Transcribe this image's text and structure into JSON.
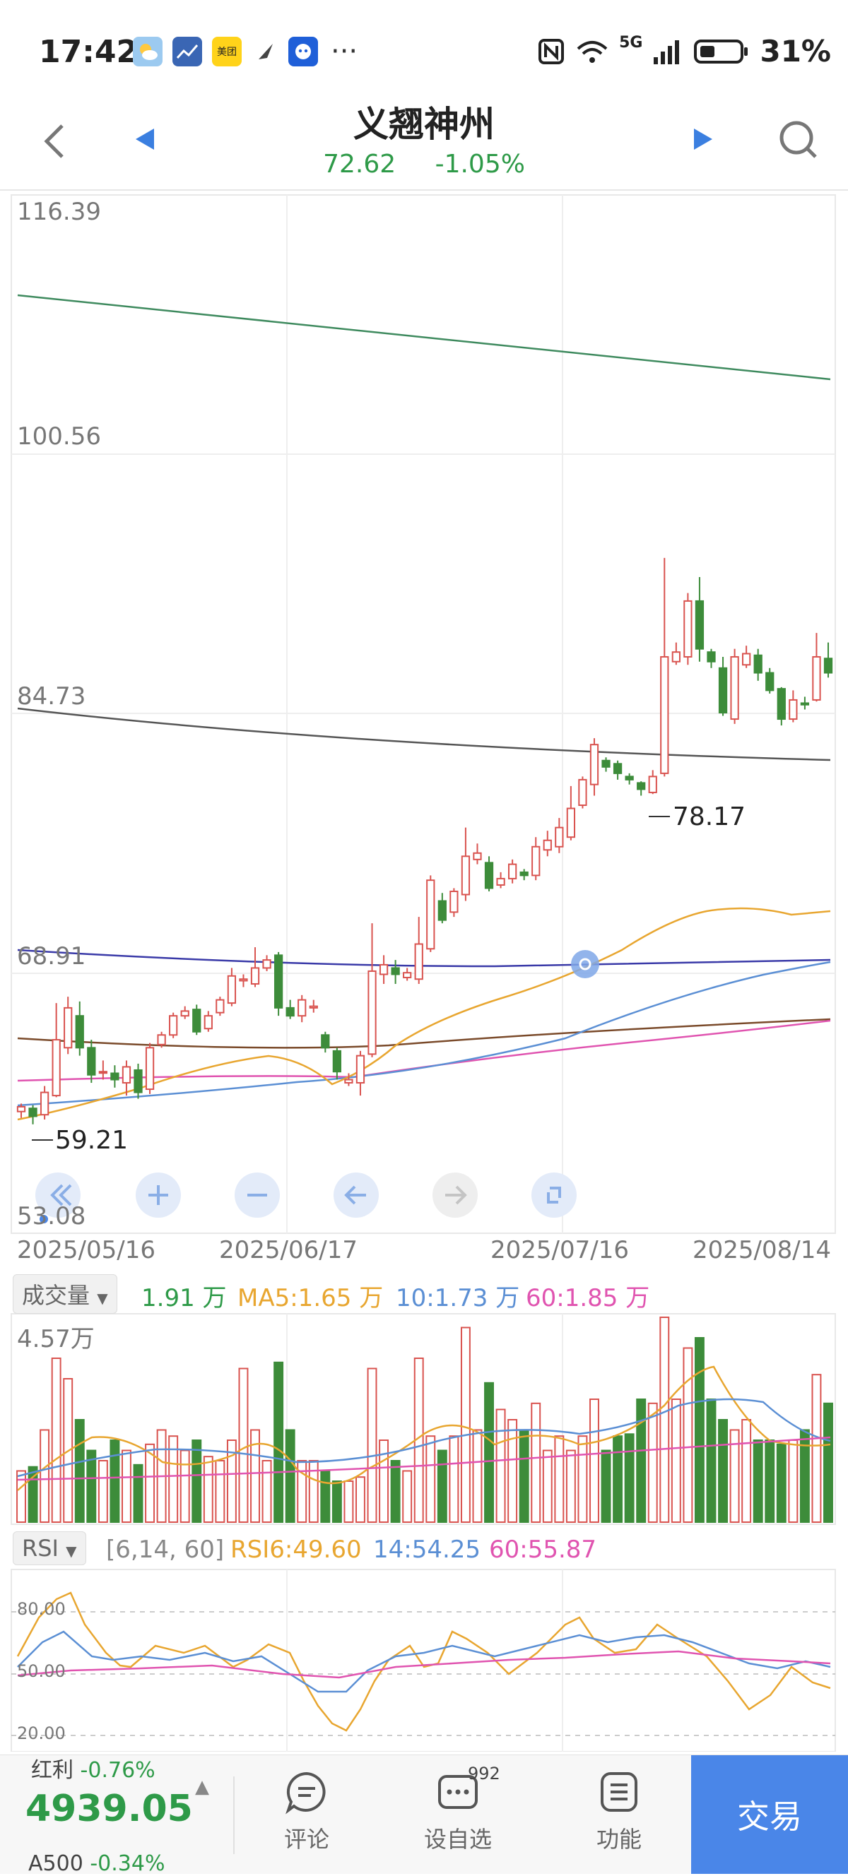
{
  "status": {
    "time": "17:42",
    "app_icons": [
      "weather-icon",
      "stocks-icon",
      "meituan-icon",
      "feather-icon",
      "bot-icon"
    ],
    "meituan_label": "美团",
    "more": "···",
    "network": "5G",
    "battery": "31%"
  },
  "header": {
    "title": "义翘神州",
    "price": "72.62",
    "change": "-1.05%"
  },
  "price_axis": [
    "116.39",
    "100.56",
    "84.73",
    "68.91",
    "53.08"
  ],
  "annotations": {
    "high": "78.17",
    "low": "59.21"
  },
  "dates": [
    "2025/05/16",
    "2025/06/17",
    "2025/07/16",
    "2025/08/14"
  ],
  "chart_tools": [
    "rewind-icon",
    "zoom-in-icon",
    "zoom-out-icon",
    "left-arrow-icon",
    "right-arrow-icon",
    "fullscreen-icon"
  ],
  "volume": {
    "selector": "成交量",
    "current": "1.91 万",
    "ma5": "MA5:1.65 万",
    "ma10": "10:1.73 万",
    "ma60": "60:1.85 万",
    "max_label": "4.57万"
  },
  "rsi": {
    "selector": "RSI",
    "params": "[6,14, 60]",
    "rsi6": "RSI6:49.60",
    "rsi14": "14:54.25",
    "rsi60": "60:55.87",
    "levels": [
      "80.00",
      "50.00",
      "20.00"
    ]
  },
  "bottom": {
    "index_top": "红利",
    "index_top_change": "-0.76%",
    "index_value": "4939.05",
    "index_bottom": "A500",
    "index_bottom_change": "-0.34%",
    "comment": "评论",
    "watch": "设自选",
    "watch_count": "992",
    "functions": "功能",
    "trade": "交易"
  },
  "colors": {
    "up": "#d9534f",
    "down": "#3d8c3a",
    "ma5": "#e8a630",
    "ma10": "#5b8fd4",
    "ma60": "#e054b0",
    "accent": "#4a86e8"
  },
  "chart_data": {
    "type": "candlestick",
    "ylim": [
      53.08,
      116.39
    ],
    "candles": [
      [
        60.0,
        60.3,
        59.6,
        60.5
      ],
      [
        60.2,
        59.7,
        59.2,
        60.4
      ],
      [
        59.8,
        61.2,
        59.5,
        61.6
      ],
      [
        61.0,
        64.5,
        60.9,
        66.8
      ],
      [
        64.0,
        66.5,
        63.6,
        67.2
      ],
      [
        66.0,
        64.0,
        63.5,
        66.9
      ],
      [
        64.0,
        62.3,
        61.8,
        64.5
      ],
      [
        62.5,
        62.5,
        62.0,
        63.2
      ],
      [
        62.4,
        62.0,
        61.5,
        62.9
      ],
      [
        61.8,
        62.8,
        61.0,
        63.2
      ],
      [
        62.6,
        61.2,
        60.8,
        63.0
      ],
      [
        61.4,
        64.0,
        61.1,
        64.3
      ],
      [
        64.2,
        64.8,
        64.0,
        65.0
      ],
      [
        64.8,
        66.0,
        64.6,
        66.2
      ],
      [
        66.0,
        66.3,
        65.8,
        66.6
      ],
      [
        66.4,
        65.0,
        64.8,
        66.7
      ],
      [
        65.2,
        66.0,
        65.0,
        66.3
      ],
      [
        66.2,
        67.0,
        66.0,
        67.2
      ],
      [
        66.8,
        68.5,
        66.6,
        69.0
      ],
      [
        68.2,
        68.3,
        67.8,
        68.6
      ],
      [
        68.0,
        69.0,
        67.8,
        70.3
      ],
      [
        69.0,
        69.5,
        68.8,
        69.8
      ],
      [
        69.8,
        66.5,
        66.0,
        70.0
      ],
      [
        66.5,
        66.0,
        65.8,
        67.0
      ],
      [
        66.0,
        67.0,
        65.6,
        67.3
      ],
      [
        66.5,
        66.6,
        66.2,
        67.0
      ],
      [
        64.8,
        64.0,
        63.7,
        65.0
      ],
      [
        63.8,
        62.5,
        62.0,
        64.0
      ],
      [
        61.8,
        62.0,
        61.6,
        62.4
      ],
      [
        61.8,
        63.5,
        61.0,
        63.8
      ],
      [
        63.6,
        68.8,
        63.4,
        71.8
      ],
      [
        68.6,
        69.2,
        68.0,
        69.8
      ],
      [
        69.0,
        68.6,
        68.0,
        69.5
      ],
      [
        68.4,
        68.7,
        68.2,
        69.0
      ],
      [
        68.3,
        70.5,
        68.0,
        72.2
      ],
      [
        70.2,
        74.5,
        70.0,
        74.8
      ],
      [
        73.2,
        72.0,
        71.8,
        73.7
      ],
      [
        72.5,
        73.8,
        72.2,
        74.0
      ],
      [
        73.6,
        76.0,
        73.2,
        77.8
      ],
      [
        75.8,
        76.2,
        75.5,
        76.8
      ],
      [
        75.6,
        74.0,
        73.8,
        76.0
      ],
      [
        74.2,
        74.6,
        74.0,
        75.0
      ],
      [
        74.6,
        75.5,
        74.3,
        75.8
      ],
      [
        75.0,
        74.8,
        74.5,
        75.2
      ],
      [
        74.8,
        76.6,
        74.5,
        77.2
      ],
      [
        76.4,
        77.0,
        76.0,
        77.6
      ],
      [
        76.6,
        77.8,
        76.2,
        78.4
      ],
      [
        77.2,
        79.0,
        77.0,
        80.4
      ],
      [
        79.2,
        80.8,
        79.0,
        81.0
      ],
      [
        80.5,
        83.0,
        79.8,
        83.4
      ],
      [
        82.0,
        81.6,
        81.3,
        82.2
      ],
      [
        81.8,
        81.2,
        80.8,
        82.0
      ],
      [
        81.0,
        80.8,
        80.5,
        81.2
      ],
      [
        80.6,
        80.2,
        79.8,
        80.7
      ],
      [
        80.0,
        81.0,
        79.9,
        81.4
      ],
      [
        81.2,
        88.5,
        81.0,
        94.7
      ],
      [
        88.2,
        88.8,
        88.0,
        89.4
      ],
      [
        88.5,
        92.0,
        88.0,
        92.5
      ],
      [
        92.0,
        89.0,
        88.2,
        93.5
      ],
      [
        88.8,
        88.2,
        87.8,
        89.0
      ],
      [
        87.8,
        85.0,
        84.8,
        88.5
      ],
      [
        84.6,
        88.5,
        84.3,
        89.0
      ],
      [
        88.0,
        88.7,
        87.8,
        89.2
      ],
      [
        88.6,
        87.5,
        87.0,
        89.0
      ],
      [
        87.5,
        86.4,
        86.2,
        87.8
      ],
      [
        86.5,
        84.6,
        84.2,
        86.6
      ],
      [
        84.6,
        85.8,
        84.4,
        86.4
      ],
      [
        85.6,
        85.5,
        85.2,
        86.0
      ],
      [
        85.8,
        88.5,
        85.7,
        90.0
      ],
      [
        88.4,
        87.5,
        87.2,
        89.4
      ]
    ]
  }
}
